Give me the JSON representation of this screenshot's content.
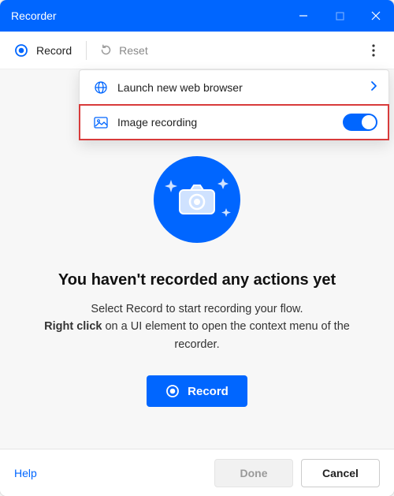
{
  "window": {
    "title": "Recorder"
  },
  "toolbar": {
    "record_label": "Record",
    "reset_label": "Reset"
  },
  "dropdown": {
    "launch_browser_label": "Launch new web browser",
    "image_recording_label": "Image recording",
    "image_recording_on": true
  },
  "empty_state": {
    "heading": "You haven't recorded any actions yet",
    "line1": "Select Record to start recording your flow.",
    "line2a": "Right click",
    "line2b": " on a UI element to open the context menu of the recorder."
  },
  "buttons": {
    "primary_record": "Record",
    "help": "Help",
    "done": "Done",
    "cancel": "Cancel"
  },
  "colors": {
    "accent": "#0066FF"
  }
}
